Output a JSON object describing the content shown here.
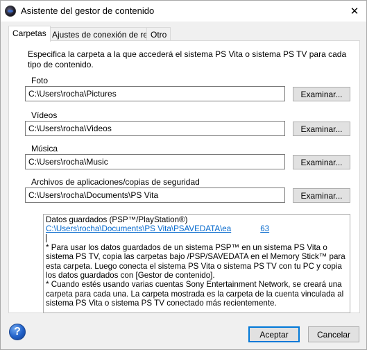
{
  "window": {
    "title": "Asistente del gestor de contenido",
    "close_glyph": "✕",
    "app_icon": "playstation-icon"
  },
  "tabs": [
    {
      "label": "Carpetas",
      "active": true
    },
    {
      "label": "Ajustes de conexión de red",
      "active": false
    },
    {
      "label": "Otro",
      "active": false
    }
  ],
  "folders": {
    "intro": "Especifica la carpeta a la que accederá el sistema PS Vita o sistema PS TV para cada tipo de contenido.",
    "browse_label": "Examinar...",
    "items": [
      {
        "label": "Foto",
        "value": "C:\\Users\\rocha\\Pictures"
      },
      {
        "label": "Vídeos",
        "value": "C:\\Users\\rocha\\Videos"
      },
      {
        "label": "Música",
        "value": "C:\\Users\\rocha\\Music"
      },
      {
        "label": "Archivos de aplicaciones/copias de seguridad",
        "value": "C:\\Users\\rocha\\Documents\\PS Vita"
      }
    ]
  },
  "info": {
    "heading": "Datos guardados (PSP™/PlayStation®)",
    "link_path": "C:\\Users\\rocha\\Documents\\PS Vita\\PSAVEDATA\\ea",
    "link_suffix": "63",
    "note1": "* Para usar los datos guardados de un sistema PSP™ en un sistema PS Vita o sistema PS TV, copia las carpetas bajo /PSP/SAVEDATA en el Memory Stick™ para esta carpeta. Luego conecta el sistema PS Vita o sistema PS TV con tu PC y copia los datos guardados con [Gestor de contenido].",
    "note2": "* Cuando estés usando varias cuentas Sony Entertainment Network, se creará una carpeta para cada una. La carpeta mostrada es la carpeta de la cuenta vinculada al sistema PS Vita o sistema PS TV conectado más recientemente."
  },
  "footer": {
    "help_glyph": "?",
    "accept_label": "Aceptar",
    "cancel_label": "Cancelar"
  },
  "colors": {
    "accent": "#0078d7",
    "link": "#0066cc"
  }
}
